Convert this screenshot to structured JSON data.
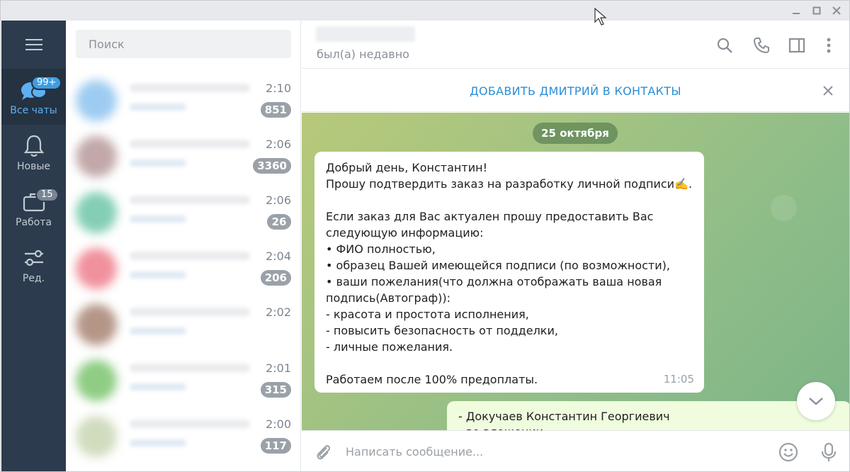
{
  "sidebar": {
    "folders": [
      {
        "label": "Все чаты",
        "badge": "99+",
        "icon": "chats-icon"
      },
      {
        "label": "Новые",
        "badge": "",
        "icon": "bell-icon"
      },
      {
        "label": "Работа",
        "badge": "15",
        "icon": "briefcase-icon"
      },
      {
        "label": "Ред.",
        "badge": "",
        "icon": "sliders-icon"
      }
    ]
  },
  "chatlist": {
    "search_placeholder": "Поиск",
    "rows": [
      {
        "time": "2:10",
        "count": "851"
      },
      {
        "time": "2:06",
        "count": "3360"
      },
      {
        "time": "2:06",
        "count": "26"
      },
      {
        "time": "2:04",
        "count": "206"
      },
      {
        "time": "2:02",
        "count": ""
      },
      {
        "time": "2:01",
        "count": "315"
      },
      {
        "time": "2:00",
        "count": "117"
      }
    ]
  },
  "chat": {
    "status": "был(а) недавно",
    "add_contact": "ДОБАВИТЬ ДМИТРИЙ В КОНТАКТЫ",
    "date": "25 октября",
    "message_in": {
      "text": "Добрый день, Константин!\nПрошу подтвердить заказ на разработку личной подписи✍️.\n\nЕсли заказ для Вас актуален прошу предоставить Вас следующую информацию:\n• ФИО полностью,\n• образец Вашей имеющейся подписи (по возможности),\n• ваши пожелания(что должна отображать ваша новая подпись(Автограф)):\n- красота и простота исполнения,\n- повысить безопасность от подделки,\n- личные пожелания.\n\nРаботаем после 100% предоплаты.",
      "time": "11:05"
    },
    "message_out": {
      "text": "- Докучаев Константин Георгиевич\n- во вложении"
    },
    "composer_placeholder": "Написать сообщение..."
  },
  "colors": {
    "rail_bg": "#2c3c4e",
    "accent": "#3f9de2",
    "link": "#2b8ed6",
    "outgoing_bubble": "#effdde"
  }
}
